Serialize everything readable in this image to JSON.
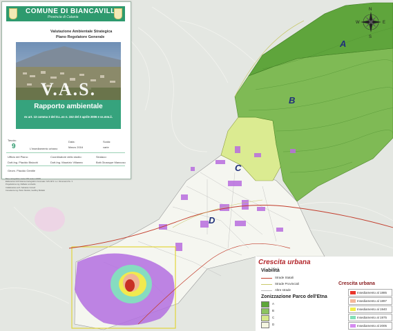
{
  "cover": {
    "municipality": "COMUNE DI BIANCAVILLA",
    "province": "Provincia di Catania",
    "subtitle_1": "Valutazione Ambientale Strategica",
    "subtitle_2": "Piano Regolatore Generale",
    "vas_title": "V.A.S.",
    "report_title": "Rapporto ambientale",
    "law_reference": "ex art. 13 comma 3 del D.L.vo n. 152 del 3 aprile 2006 e ss.mm.ii.",
    "table_label": "Tavola:",
    "table_number": "9",
    "table_subject": "L'insediamento urbano",
    "date_label": "Data:",
    "date_value": "Marzo 2016",
    "scale_label": "Scala:",
    "scale_value": "varie",
    "office_label": "Ufficio del Piano:",
    "coordinator_label": "Coordinatore dello studio:",
    "mayor_label": "Sindaco:",
    "tech_1": "Dott.Ing. Placido Bisicchi",
    "tech_2": "Dott.Ing. Maurizio Villanea",
    "mayor_name": "Bott.Giuseppe Mancuso",
    "tech_3": "Geom. Placido Gentile"
  },
  "notes": [
    "Base cartografica: Carta CTR scala 1:10000",
    "Elaborazioni GIS Sistema Cartografico Comunale / GIS 1974 / e.c. Dimensioni SL / 1",
    "Progettazione ing. Raffaele Lombardo",
    "Collaboratore arch. Salvatore Consoli",
    "Consulenza ing. Pietro Nicolosi, Geoffrey Moltalto"
  ],
  "zones": {
    "a": "A",
    "b": "B",
    "c": "C",
    "d": "D"
  },
  "legend": {
    "title": "Crescita urbana",
    "viability_title": "Viabilità",
    "roads": [
      {
        "label": "Strade Statali",
        "color": "#c23b2a"
      },
      {
        "label": "Strade Provinciali",
        "color": "#c8c86a"
      },
      {
        "label": "Altre strade",
        "color": "#bbbbbb"
      }
    ],
    "park_title": "Zonizzazione Parco dell'Etna",
    "park_zones": [
      {
        "label": "A",
        "color": "#5ea73a"
      },
      {
        "label": "B",
        "color": "#8cc460"
      },
      {
        "label": "C",
        "color": "#d6e98b"
      },
      {
        "label": "D",
        "color": "#f4f5e0"
      }
    ],
    "growth_title": "Crescita urbana",
    "growth": [
      {
        "label": "Insediamento al 1885",
        "color": "#e8352c"
      },
      {
        "label": "Insediamento al 1897",
        "color": "#f4b79a"
      },
      {
        "label": "Insediamento al 1940",
        "color": "#f2ee4a"
      },
      {
        "label": "Insediamento al 1975",
        "color": "#84e0b8"
      },
      {
        "label": "Insediamento al 2005",
        "color": "#d58cf0"
      }
    ]
  },
  "colors": {
    "background": "#e6e8e3",
    "zone_a": "#5ea73a",
    "zone_b": "#7dba52",
    "zone_c": "#d6e98b",
    "zone_d": "#f4f5e8",
    "growth_2005": "#b560e0",
    "roads_state": "#c23b2a",
    "header_green": "#2e9a6e"
  },
  "icons": [
    "compass-rose-icon",
    "municipal-crest-icon"
  ]
}
